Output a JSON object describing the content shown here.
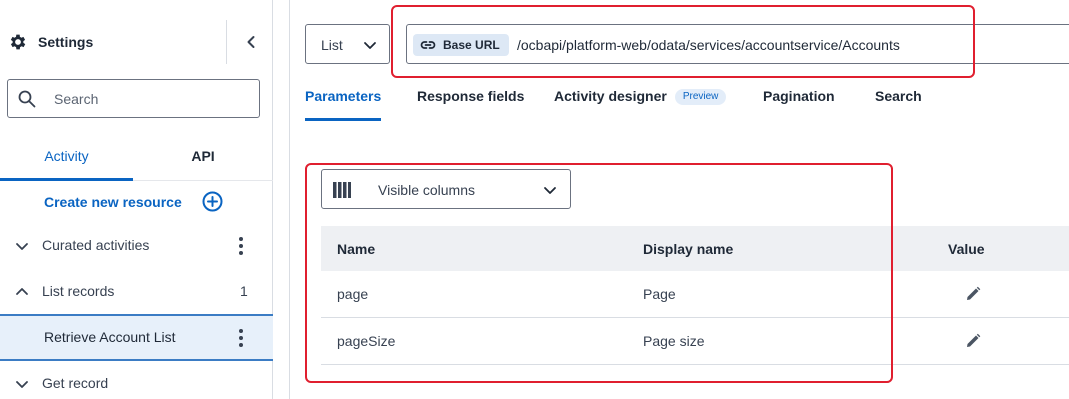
{
  "sidebar": {
    "title": "Settings",
    "search": {
      "placeholder": "Search",
      "value": ""
    },
    "tabs": [
      {
        "label": "Activity",
        "active": true
      },
      {
        "label": "API",
        "active": false
      }
    ],
    "create_label": "Create new resource",
    "items": [
      {
        "label": "Curated activities",
        "expanded": false,
        "count": ""
      },
      {
        "label": "List records",
        "expanded": true,
        "count": "1"
      },
      {
        "label": "Retrieve Account List",
        "selected": true
      },
      {
        "label": "Get record",
        "expanded": false
      }
    ]
  },
  "request": {
    "method": "List",
    "base_url_label": "Base URL",
    "url": "/ocbapi/platform-web/odata/services/accountservice/Accounts"
  },
  "tabs": [
    {
      "label": "Parameters",
      "active": true
    },
    {
      "label": "Response fields",
      "active": false
    },
    {
      "label": "Activity designer",
      "badge": "Preview",
      "active": false
    },
    {
      "label": "Pagination",
      "active": false
    },
    {
      "label": "Search",
      "active": false
    }
  ],
  "columns_button": "Visible columns",
  "table": {
    "headers": [
      "Name",
      "Display name",
      "Value"
    ],
    "rows": [
      {
        "name": "page",
        "display_name": "Page"
      },
      {
        "name": "pageSize",
        "display_name": "Page size"
      }
    ]
  },
  "colors": {
    "accent": "#0a64c2",
    "highlight": "#e01f2f"
  }
}
